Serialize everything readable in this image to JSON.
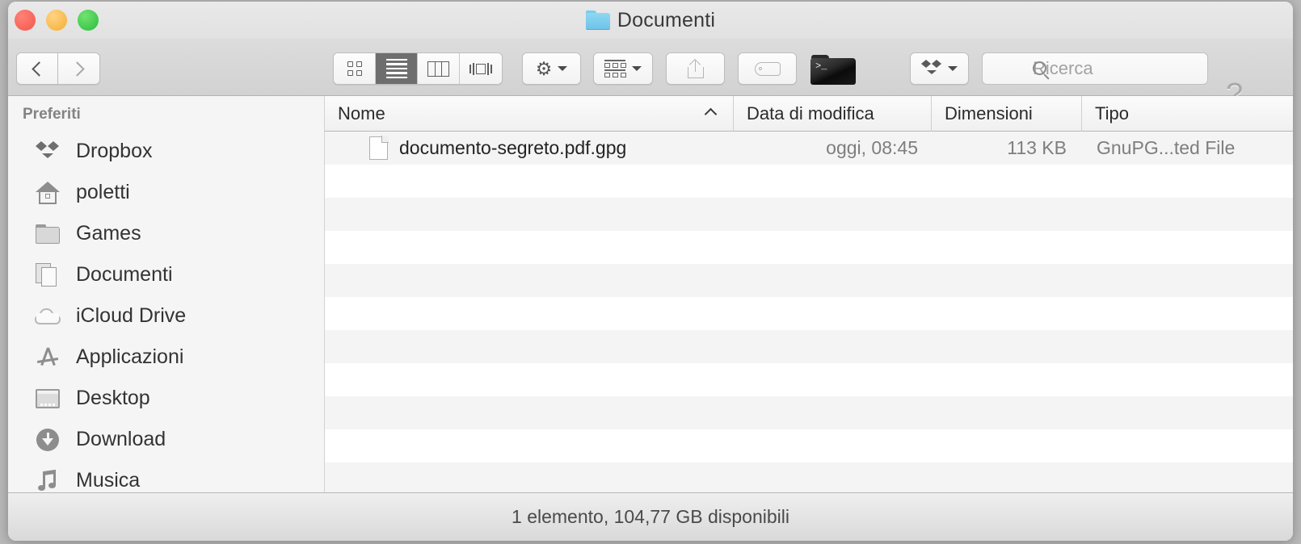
{
  "window": {
    "title": "Documenti",
    "title_icon": "blue-folder-icon",
    "traffic_lights": [
      "close-red",
      "minimize-yellow",
      "zoom-green"
    ]
  },
  "toolbar": {
    "back_label": "Indietro",
    "forward_label": "Avanti",
    "view_modes": [
      {
        "name": "icon-view",
        "selected": false
      },
      {
        "name": "list-view",
        "selected": true
      },
      {
        "name": "column-view",
        "selected": false
      },
      {
        "name": "coverflow-view",
        "selected": false
      }
    ],
    "action_menu": "gear-icon",
    "arrange_menu": "arrange-icon",
    "share_button": "share-icon",
    "tag_button": "tag-icon",
    "terminal_button": "terminal-folder-icon",
    "dropbox_menu": "dropbox-icon",
    "help_glyph": "?"
  },
  "search": {
    "placeholder": "Ricerca",
    "value": "",
    "icon": "search-icon"
  },
  "sidebar": {
    "header": "Preferiti",
    "items": [
      {
        "label": "Dropbox",
        "icon": "dropbox-icon"
      },
      {
        "label": "poletti",
        "icon": "home-icon"
      },
      {
        "label": "Games",
        "icon": "folder-icon"
      },
      {
        "label": "Documenti",
        "icon": "documents-icon"
      },
      {
        "label": "iCloud Drive",
        "icon": "cloud-icon"
      },
      {
        "label": "Applicazioni",
        "icon": "applications-icon"
      },
      {
        "label": "Desktop",
        "icon": "desktop-icon"
      },
      {
        "label": "Download",
        "icon": "download-icon"
      },
      {
        "label": "Musica",
        "icon": "music-icon"
      }
    ]
  },
  "file_list": {
    "columns": [
      {
        "label": "Nome",
        "sorted": true,
        "sort_direction": "asc"
      },
      {
        "label": "Data di modifica"
      },
      {
        "label": "Dimensioni"
      },
      {
        "label": "Tipo"
      }
    ],
    "rows": [
      {
        "name": "documento-segreto.pdf.gpg",
        "icon": "document-icon",
        "date": "oggi, 08:45",
        "size": "113 KB",
        "type": "GnuPG...ted File"
      }
    ]
  },
  "status_bar": {
    "text": "1 elemento, 104,77 GB disponibili"
  }
}
